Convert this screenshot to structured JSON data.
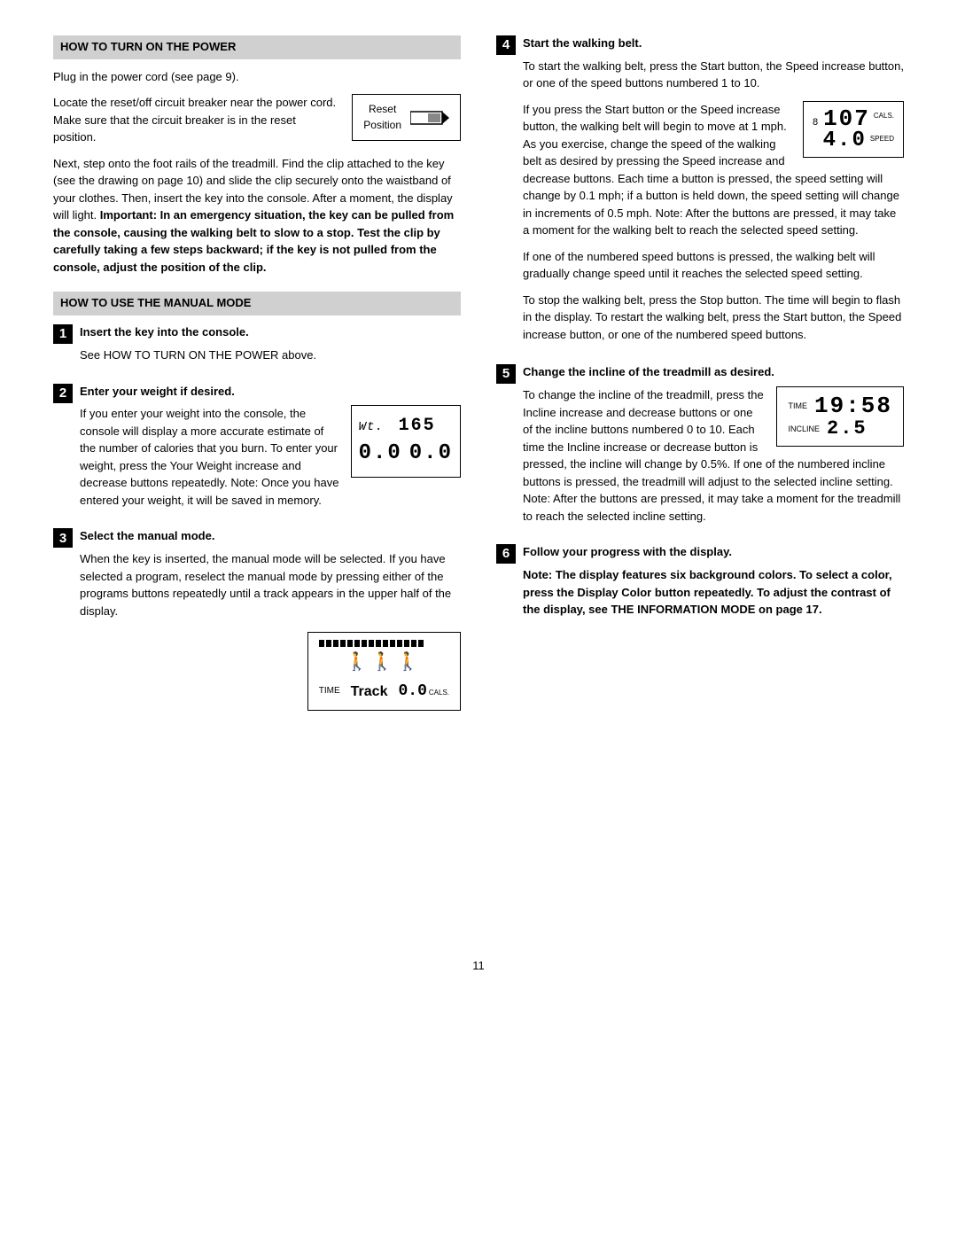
{
  "page": {
    "number": "11"
  },
  "left": {
    "section1": {
      "heading": "HOW TO TURN ON THE POWER",
      "para1": "Plug in the power cord (see page 9).",
      "para2_start": "Locate the reset/off circuit breaker near the power cord. Make sure that the circuit breaker is in the reset position.",
      "reset_diagram": {
        "label_line1": "Reset",
        "label_line2": "Position"
      },
      "para3": "Next, step onto the foot rails of the treadmill. Find the clip attached to the key (see the drawing on page 10) and slide the clip securely onto the waistband of your clothes. Then, insert the key into the console. After a moment, the display will light.",
      "para3_bold": "Important: In an emergency situation, the key can be pulled from the console, causing the walking belt to slow to a stop.",
      "para3_cont": "Test the clip by carefully taking a few steps backward; if the key is not pulled from the console, adjust the position of the clip."
    },
    "section2": {
      "heading": "HOW TO USE THE MANUAL MODE",
      "step1": {
        "number": "1",
        "title": "Insert the key into the console.",
        "para1": "See HOW TO TURN ON THE POWER above."
      },
      "step2": {
        "number": "2",
        "title": "Enter your weight if desired.",
        "para1": "If you enter your weight into the console, the console will display a more accurate estimate of the number of calories that you burn. To enter your weight, press the Your Weight increase and decrease buttons repeatedly. Note: Once you have entered your weight, it will be saved in memory.",
        "display": {
          "top": "Wt.  165",
          "bot1": "0.0",
          "bot2": "0.0"
        }
      },
      "step3": {
        "number": "3",
        "title": "Select the manual mode.",
        "para1": "When the key is inserted, the manual mode will be selected. If you have selected a program, reselect the manual mode by pressing either of the programs buttons repeatedly until a track appears in the upper half of the display.",
        "display": {
          "track_label": "TIME",
          "track_word": "Track",
          "cals": "0.0",
          "cals_label": "CALS."
        }
      }
    }
  },
  "right": {
    "step4": {
      "number": "4",
      "title": "Start the walking belt.",
      "para1": "To start the walking belt, press the Start button, the Speed increase button, or one of the speed buttons numbered 1 to 10.",
      "para2": "If you press the Start button or the Speed increase button, the walking belt will begin to move at 1 mph. As you exercise, change the speed of the walking belt as desired by pressing the Speed increase and decrease buttons. Each time a button is pressed, the speed setting will change by 0.1 mph; if a button is held down, the speed setting will change in increments of 0.5 mph. Note: After the buttons are pressed, it may take a moment for the walking belt to reach the selected speed setting.",
      "display": {
        "calories": "107",
        "cals_label": "CALS.",
        "speed": "4.0",
        "speed_label": "SPEED"
      },
      "para3": "If one of the numbered speed buttons is pressed, the walking belt will gradually change speed until it reaches the selected speed setting.",
      "para4": "To stop the walking belt, press the Stop button. The time will begin to flash in the display. To restart the walking belt, press the Start button, the Speed increase button, or one of the numbered speed buttons."
    },
    "step5": {
      "number": "5",
      "title": "Change the incline of the treadmill as desired.",
      "para1": "To change the incline of the treadmill, press the Incline increase and decrease buttons or one of the incline buttons numbered 0 to 10. Each time the Incline increase or decrease button is pressed, the incline will change by 0.5%. If one of the numbered incline buttons is pressed, the treadmill will adjust to the selected incline setting. Note: After the buttons are pressed, it may take a moment for the treadmill to reach the selected incline setting.",
      "display": {
        "time_label": "TIME",
        "time_val": "19:58",
        "incline_label": "INCLINE",
        "incline_val": "2.5"
      }
    },
    "step6": {
      "number": "6",
      "title": "Follow your progress with the display.",
      "para1": "Note: The display features six background colors. To select a color, press the Display Color button repeatedly. To adjust the contrast of the display, see THE INFORMATION MODE on page 17."
    }
  }
}
